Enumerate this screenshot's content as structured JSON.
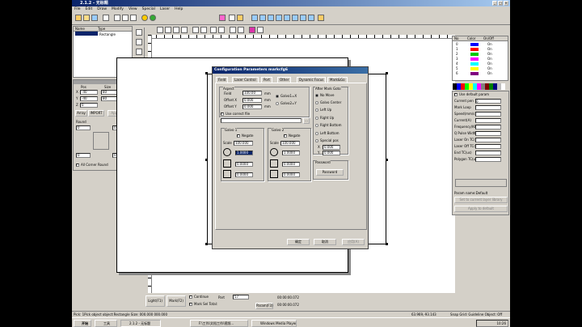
{
  "app": {
    "title": "2.1.2 - 无标题"
  },
  "menu": [
    "File",
    "Edit",
    "Draw",
    "Modify",
    "View",
    "Special",
    "Laser",
    "Help"
  ],
  "object_list": {
    "headers": [
      "Name",
      "Type"
    ],
    "rows": [
      {
        "name": "",
        "type": "Rectangle"
      }
    ]
  },
  "size_panel": {
    "pos_label": "Pos",
    "size_label": "Size",
    "x_label": "X",
    "y_label": "Y",
    "z_label": "Z",
    "x_pos": "-40",
    "y_pos": "-40",
    "z_pos": "0",
    "x_size": "80",
    "y_size": "80",
    "array_label": "Array",
    "import_label": "IMPORT",
    "apply_label": "Apply",
    "round_label": "Round",
    "round_values": [
      "0",
      "0",
      "0",
      "0"
    ],
    "all_corner_label": "All Corner Round"
  },
  "dialog": {
    "title": "Configuration Parameters markcfg6",
    "tabs": [
      "Field",
      "Laser Control",
      "Port",
      "Other",
      "Dynamic Focus",
      "Mark&Go"
    ],
    "aspect_label": "Aspect",
    "field_label": "Field",
    "field_value": "100.00",
    "field_unit": "mm",
    "offset_x_label": "Offset X",
    "offset_x_value": "0.000",
    "offset_y_label": "Offset Y",
    "offset_y_value": "0.000",
    "unit_mm": "mm",
    "galvo_a": "Galvo1=X",
    "galvo_b": "Galvo2=Y",
    "correct_file_label": "Use correct file",
    "galvo1_label": "Galvo 1",
    "galvo2_label": "Galvo 2",
    "negate_label": "Negate",
    "scale_label": "Scale",
    "galvo1_scale": "100.000",
    "galvo2_scale": "100.000",
    "g1_vals": [
      "1.0000",
      "0.0000",
      "0.0000"
    ],
    "g2_vals": [
      "1.0000",
      "0.0000",
      "0.0000"
    ],
    "after_mark_label": "After Mark Goto",
    "goto_options": [
      "No Move",
      "Galvo Center",
      "Left Up",
      "Right Up",
      "Right Bottom",
      "Left Bottom",
      "Special pos"
    ],
    "special_x_label": "X",
    "special_x": "0.000",
    "special_y_label": "Y",
    "special_y": "0.000",
    "password_group": "Password",
    "password_btn": "Password",
    "ok": "确定",
    "cancel": "取消",
    "apply": "应用(A)"
  },
  "layers": {
    "headers": [
      "No",
      "Color",
      "On/Off"
    ],
    "rows": [
      {
        "no": "0",
        "color": "#0000ff",
        "state": "On"
      },
      {
        "no": "1",
        "color": "#ff0000",
        "state": "On"
      },
      {
        "no": "2",
        "color": "#00cc00",
        "state": "On"
      },
      {
        "no": "3",
        "color": "#ff00ff",
        "state": "On"
      },
      {
        "no": "4",
        "color": "#00ffff",
        "state": "On"
      },
      {
        "no": "5",
        "color": "#ffff00",
        "state": "On"
      },
      {
        "no": "6",
        "color": "#800080",
        "state": "On"
      }
    ]
  },
  "palette": [
    "#000000",
    "#0000ff",
    "#ff0000",
    "#00ff00",
    "#ffff00",
    "#00ffff",
    "#ff00ff",
    "#808080",
    "#800000",
    "#008000",
    "#000080",
    "#c0c0c0",
    "#ffffff"
  ],
  "params": {
    "use_default": "Use default param",
    "rows": [
      "Current pen",
      "Mark Loop",
      "Speed(mm/s)",
      "Current(A)",
      "Frequency(KHz)",
      "Q Pulse Width(u",
      "Laser On TC(us)",
      "Laser Off TC(us)",
      "End TC(us)",
      "Polygon TC(us)"
    ],
    "current_pen": "0",
    "param_name": "Param name:Default",
    "btn1": "Set to current layer library",
    "btn2": "Apply to default"
  },
  "bottom": {
    "light": "Light(F1)",
    "mark": "Mark(F2)",
    "continue": "Continue",
    "mark_sel": "Mark Sel Total:",
    "part_label": "Part",
    "part_value": "57",
    "param_btn": "Param(F3)",
    "time1": "00:00:00.072",
    "time2": "00:00:00.072"
  },
  "status": {
    "left": "Pick: 1Pick object object:Rectangle Size: 000.000 000.000",
    "coords": "63.969,-93.143",
    "right": "Snap Grid: Guideline Object: Off"
  },
  "taskbar": {
    "start": "开始",
    "items": [
      "工具",
      "2.1.2 - 无标题",
      "F:\\工作\\文档工作\\视频...",
      "Windows Media Player"
    ],
    "clock": "10:26"
  }
}
